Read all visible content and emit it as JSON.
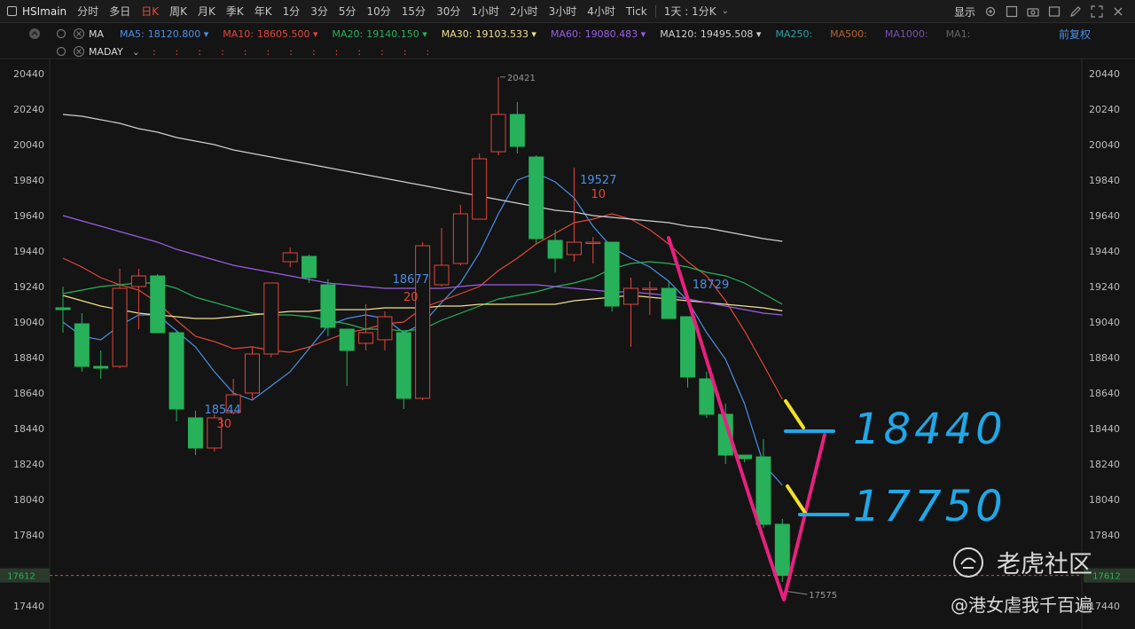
{
  "toolbar": {
    "symbol": "HSImain",
    "periods": [
      "分时",
      "多日",
      "日K",
      "周K",
      "月K",
      "季K",
      "年K",
      "1分",
      "3分",
      "5分",
      "10分",
      "15分",
      "30分",
      "1小时",
      "2小时",
      "3小时",
      "4小时",
      "Tick"
    ],
    "active_period": "日K",
    "range_select": "1天 : 1分K",
    "display_label": "显示"
  },
  "ma_row": {
    "label": "MA",
    "items": [
      {
        "name": "MA5:",
        "value": "18120.800",
        "color": "#4b8fe6"
      },
      {
        "name": "MA10:",
        "value": "18605.500",
        "color": "#e2463b"
      },
      {
        "name": "MA20:",
        "value": "19140.150",
        "color": "#26b15a"
      },
      {
        "name": "MA30:",
        "value": "19103.533",
        "color": "#f3df8c"
      },
      {
        "name": "MA60:",
        "value": "19080.483",
        "color": "#9a5de8"
      },
      {
        "name": "MA120:",
        "value": "19495.508",
        "color": "#cfcfcf"
      },
      {
        "name": "MA250:",
        "value": "",
        "color": "#2aa0a0"
      },
      {
        "name": "MA500:",
        "value": "",
        "color": "#b8632c"
      },
      {
        "name": "MA1000:",
        "value": "",
        "color": "#7a4fb0"
      },
      {
        "name": "MA1:",
        "value": "",
        "color": "#666666"
      }
    ],
    "adjust_label": "前复权"
  },
  "maday_row": {
    "label": "MADAY",
    "colons": [
      ":",
      ":",
      ":",
      ":",
      ":",
      ":",
      ":",
      ":",
      ":",
      ":",
      ":",
      ":",
      ":"
    ]
  },
  "chart_data": {
    "type": "candlestick",
    "ylim": [
      17400,
      20520
    ],
    "y_ticks": [
      20440,
      20240,
      20040,
      19840,
      19640,
      19440,
      19240,
      19040,
      18840,
      18640,
      18440,
      18240,
      18040,
      17840,
      17440
    ],
    "up_color": "#e2463b",
    "down_color": "#26b15a",
    "current_price": "17612",
    "candles": [
      {
        "o": 19120,
        "h": 19240,
        "l": 18980,
        "c": 19110
      },
      {
        "o": 19030,
        "h": 19090,
        "l": 18760,
        "c": 18790
      },
      {
        "o": 18790,
        "h": 18880,
        "l": 18720,
        "c": 18780
      },
      {
        "o": 18790,
        "h": 19340,
        "l": 18780,
        "c": 19230
      },
      {
        "o": 19240,
        "h": 19340,
        "l": 19000,
        "c": 19300
      },
      {
        "o": 19300,
        "h": 19310,
        "l": 19000,
        "c": 18980
      },
      {
        "o": 18980,
        "h": 18990,
        "l": 18480,
        "c": 18550
      },
      {
        "o": 18500,
        "h": 18540,
        "l": 18290,
        "c": 18330
      },
      {
        "o": 18330,
        "h": 18520,
        "l": 18310,
        "c": 18500
      },
      {
        "o": 18530,
        "h": 18720,
        "l": 18520,
        "c": 18630
      },
      {
        "o": 18640,
        "h": 18900,
        "l": 18600,
        "c": 18860
      },
      {
        "o": 18860,
        "h": 19260,
        "l": 18840,
        "c": 19260
      },
      {
        "o": 19380,
        "h": 19460,
        "l": 19350,
        "c": 19430
      },
      {
        "o": 19410,
        "h": 19420,
        "l": 19260,
        "c": 19290
      },
      {
        "o": 19250,
        "h": 19280,
        "l": 18960,
        "c": 19010
      },
      {
        "o": 19000,
        "h": 19000,
        "l": 18680,
        "c": 18880
      },
      {
        "o": 18920,
        "h": 19140,
        "l": 18880,
        "c": 18980
      },
      {
        "o": 18940,
        "h": 19100,
        "l": 18880,
        "c": 19070
      },
      {
        "o": 18980,
        "h": 18990,
        "l": 18550,
        "c": 18610
      },
      {
        "o": 18610,
        "h": 19490,
        "l": 18600,
        "c": 19470
      },
      {
        "o": 19250,
        "h": 19570,
        "l": 19240,
        "c": 19360
      },
      {
        "o": 19370,
        "h": 19700,
        "l": 19360,
        "c": 19650
      },
      {
        "o": 19620,
        "h": 19990,
        "l": 19620,
        "c": 19960
      },
      {
        "o": 20000,
        "h": 20421,
        "l": 19980,
        "c": 20210
      },
      {
        "o": 20210,
        "h": 20280,
        "l": 19990,
        "c": 20030
      },
      {
        "o": 19970,
        "h": 19980,
        "l": 19480,
        "c": 19510
      },
      {
        "o": 19500,
        "h": 19560,
        "l": 19320,
        "c": 19400
      },
      {
        "o": 19420,
        "h": 19910,
        "l": 19380,
        "c": 19490
      },
      {
        "o": 19490,
        "h": 19520,
        "l": 19370,
        "c": 19490
      },
      {
        "o": 19490,
        "h": 19490,
        "l": 19100,
        "c": 19130
      },
      {
        "o": 19140,
        "h": 19290,
        "l": 18900,
        "c": 19230
      },
      {
        "o": 19230,
        "h": 19270,
        "l": 19080,
        "c": 19230
      },
      {
        "o": 19230,
        "h": 19270,
        "l": 19060,
        "c": 19060
      },
      {
        "o": 19070,
        "h": 19070,
        "l": 18670,
        "c": 18730
      },
      {
        "o": 18720,
        "h": 18760,
        "l": 18500,
        "c": 18520
      },
      {
        "o": 18520,
        "h": 18580,
        "l": 18240,
        "c": 18290
      },
      {
        "o": 18290,
        "h": 18290,
        "l": 18250,
        "c": 18270
      },
      {
        "o": 18280,
        "h": 18380,
        "l": 17880,
        "c": 17900
      },
      {
        "o": 17900,
        "h": 17930,
        "l": 17575,
        "c": 17612
      }
    ],
    "ma_lines": [
      {
        "name": "MA5",
        "color": "#4b8fe6",
        "values": [
          19040,
          18960,
          18940,
          19020,
          19080,
          19080,
          18990,
          18900,
          18760,
          18640,
          18600,
          18680,
          18760,
          18890,
          19020,
          19060,
          19080,
          19060,
          18980,
          19030,
          19150,
          19260,
          19430,
          19650,
          19840,
          19880,
          19830,
          19740,
          19580,
          19460,
          19400,
          19350,
          19270,
          19160,
          18980,
          18830,
          18580,
          18240,
          18120
        ]
      },
      {
        "name": "MA10",
        "color": "#e2463b",
        "values": [
          19400,
          19350,
          19290,
          19250,
          19220,
          19150,
          19050,
          18960,
          18930,
          18890,
          18900,
          18880,
          18870,
          18900,
          18940,
          18980,
          19000,
          19030,
          19040,
          19120,
          19160,
          19200,
          19240,
          19330,
          19400,
          19480,
          19540,
          19600,
          19620,
          19650,
          19620,
          19560,
          19480,
          19380,
          19300,
          19160,
          18990,
          18800,
          18605
        ]
      },
      {
        "name": "MA20",
        "color": "#26b15a",
        "values": [
          19200,
          19220,
          19240,
          19250,
          19260,
          19260,
          19230,
          19180,
          19150,
          19120,
          19090,
          19080,
          19080,
          19070,
          19050,
          19030,
          19000,
          19000,
          18990,
          19000,
          19050,
          19090,
          19130,
          19170,
          19190,
          19210,
          19240,
          19260,
          19290,
          19340,
          19370,
          19380,
          19370,
          19350,
          19320,
          19300,
          19260,
          19200,
          19140
        ]
      },
      {
        "name": "MA30",
        "color": "#f3df8c",
        "values": [
          19190,
          19160,
          19130,
          19110,
          19090,
          19080,
          19070,
          19060,
          19060,
          19070,
          19080,
          19090,
          19100,
          19100,
          19110,
          19110,
          19110,
          19120,
          19120,
          19120,
          19130,
          19130,
          19140,
          19140,
          19140,
          19140,
          19140,
          19160,
          19170,
          19180,
          19190,
          19180,
          19170,
          19160,
          19150,
          19140,
          19130,
          19120,
          19103
        ]
      },
      {
        "name": "MA60",
        "color": "#9a5de8",
        "values": [
          19640,
          19610,
          19580,
          19550,
          19520,
          19490,
          19450,
          19420,
          19390,
          19360,
          19340,
          19320,
          19300,
          19280,
          19260,
          19250,
          19240,
          19230,
          19230,
          19230,
          19230,
          19240,
          19250,
          19250,
          19250,
          19250,
          19240,
          19230,
          19220,
          19210,
          19210,
          19200,
          19190,
          19170,
          19150,
          19130,
          19110,
          19090,
          19080
        ]
      },
      {
        "name": "MA120",
        "color": "#cfcfcf",
        "values": [
          20210,
          20200,
          20180,
          20160,
          20130,
          20110,
          20080,
          20060,
          20040,
          20010,
          19990,
          19970,
          19950,
          19930,
          19910,
          19890,
          19870,
          19850,
          19830,
          19810,
          19790,
          19770,
          19750,
          19730,
          19710,
          19690,
          19670,
          19660,
          19640,
          19630,
          19620,
          19610,
          19600,
          19580,
          19570,
          19550,
          19530,
          19510,
          19495
        ]
      }
    ],
    "annotations": [
      {
        "text": "20421",
        "value": 20421,
        "candle": 23
      },
      {
        "text": "17575",
        "value": 17575,
        "candle": 38
      },
      {
        "text": "18544",
        "value": 18544,
        "candle": 7,
        "color": "#4b8fe6"
      },
      {
        "text": "30",
        "candle": 7,
        "color": "#e2463b"
      },
      {
        "text": "18677",
        "value": 18677,
        "candle": 18,
        "color": "#4b8fe6"
      },
      {
        "text": "20",
        "candle": 18,
        "color": "#e2463b"
      },
      {
        "text": "19527",
        "value": 19527,
        "candle": 28,
        "color": "#4b8fe6"
      },
      {
        "text": "10",
        "candle": 28,
        "color": "#e2463b"
      },
      {
        "text": "18729",
        "value": 18729,
        "candle": 33,
        "color": "#4b8fe6"
      }
    ],
    "handwritten": [
      {
        "text": "18440",
        "color": "#1fa8e8"
      },
      {
        "text": "17750",
        "color": "#1fa8e8"
      }
    ]
  },
  "watermark": {
    "brand": "老虎社区",
    "user": "@港女虐我千百遍"
  }
}
